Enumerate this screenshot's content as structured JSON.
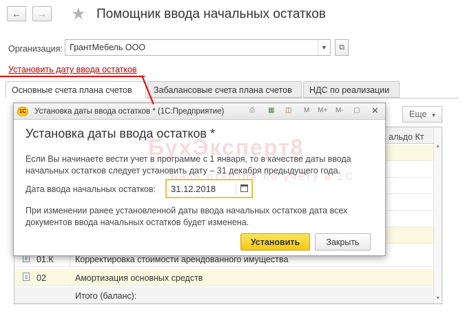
{
  "header": {
    "back_icon": "back-arrow-icon",
    "forward_icon": "forward-arrow-icon",
    "favorite_icon": "star-icon",
    "title": "Помощник ввода начальных остатков"
  },
  "organization": {
    "label": "Организация:",
    "value": "ГрантМебель ООО"
  },
  "set_date_link": "Установить дату ввода остатков",
  "tabs": [
    {
      "label": "Основные счета плана счетов",
      "active": true
    },
    {
      "label": "Забалансовые счета плана счетов",
      "active": false
    },
    {
      "label": "НДС по реализации",
      "active": false
    }
  ],
  "table": {
    "more_label": "Еще",
    "header_saldo": "альдо Кт",
    "rows": [
      {
        "code": "01.К",
        "name": "Корректировка стоимости арендованного имущества"
      },
      {
        "code": "02",
        "name": "Амортизация основных средств"
      },
      {
        "code": "",
        "name": "Итого (баланс):"
      }
    ]
  },
  "dialog": {
    "window_title": "Установка даты ввода остатков * (1С:Предприятие)",
    "toolbar_labels": [
      "M",
      "M+",
      "M-"
    ],
    "heading": "Установка даты ввода остатков *",
    "intro_line1": "Если Вы начинаете вести учет в программе с 1 января, то в качестве даты ввода",
    "intro_line2": "начальных остатков следует установить дату – 31 декабря предыдущего года.",
    "date_label": "Дата ввода начальных остатков:",
    "date_value": "31.12.2018",
    "note_line1": "При изменении ранее установленной даты ввода начальных остатков дата всех",
    "note_line2": "документов ввода начальных остатков будет изменена.",
    "set_button": "Установить",
    "close_button": "Закрыть"
  },
  "watermark": {
    "main": "БухЭксперт8",
    "sub": "База ответов по учету в 1С"
  },
  "colors": {
    "accent_yellow": "#f5c812",
    "link_red": "#c00000",
    "row_highlight": "#fbf8e0"
  }
}
